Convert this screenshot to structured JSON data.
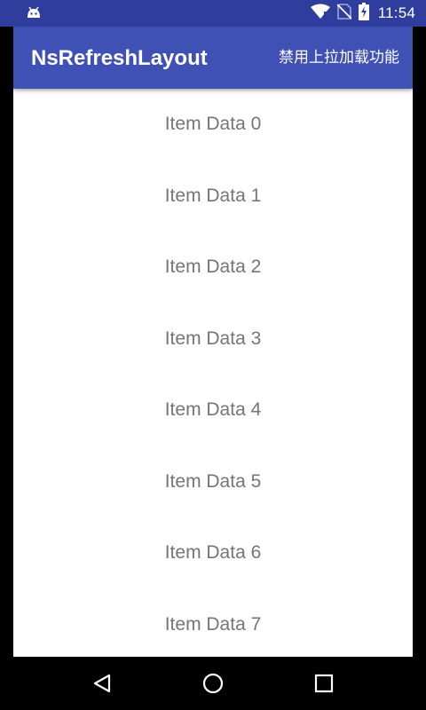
{
  "status_bar": {
    "time": "11:54",
    "icons": [
      "android-icon",
      "wifi-icon",
      "no-sim-icon",
      "battery-charging-icon"
    ],
    "background": "#2f3d9c"
  },
  "toolbar": {
    "title": "NsRefreshLayout",
    "action_label": "禁用上拉加载功能",
    "background": "#3f51b5"
  },
  "list": {
    "items": [
      "Item Data 0",
      "Item Data 1",
      "Item Data 2",
      "Item Data 3",
      "Item Data 4",
      "Item Data 5",
      "Item Data 6",
      "Item Data 7"
    ],
    "text_color": "#757575"
  },
  "nav_bar": {
    "buttons": [
      "back-icon",
      "home-icon",
      "recents-icon"
    ]
  }
}
